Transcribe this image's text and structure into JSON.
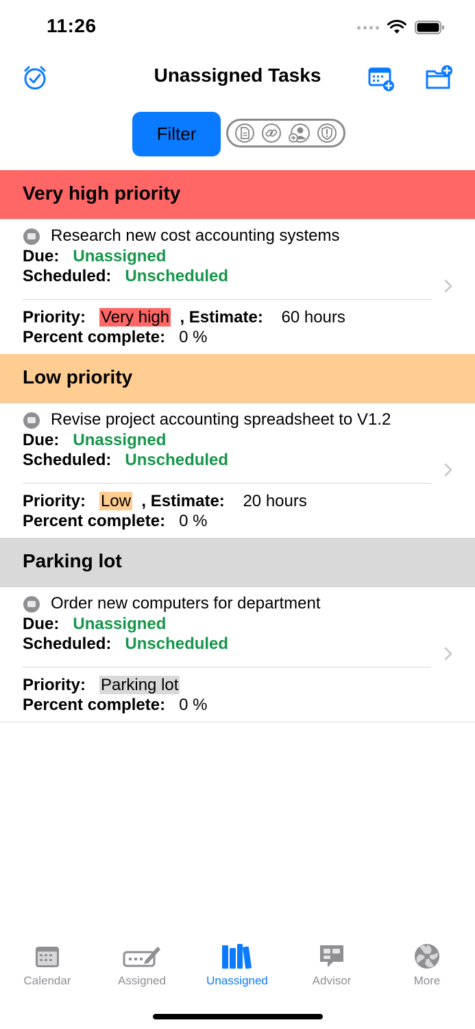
{
  "status": {
    "time": "11:26"
  },
  "nav": {
    "title": "Unassigned Tasks"
  },
  "filter": {
    "label": "Filter"
  },
  "colors": {
    "accent": "#0a7bff",
    "very_high": "#ff6666",
    "low": "#ffcd91",
    "parking": "#d9d9d9",
    "green": "#15964a"
  },
  "sections": [
    {
      "title": "Very high priority",
      "task": {
        "name": "Research new cost accounting systems",
        "due_label": "Due:",
        "due_value": "Unassigned",
        "scheduled_label": "Scheduled:",
        "scheduled_value": "Unscheduled",
        "priority_label": "Priority:",
        "priority_value": "Very high",
        "estimate_label": ", Estimate:",
        "estimate_value": "60 hours",
        "percent_label": "Percent complete:",
        "percent_value": "0  %"
      }
    },
    {
      "title": "Low priority",
      "task": {
        "name": "Revise project accounting spreadsheet to V1.2",
        "due_label": "Due:",
        "due_value": "Unassigned",
        "scheduled_label": "Scheduled:",
        "scheduled_value": "Unscheduled",
        "priority_label": "Priority:",
        "priority_value": "Low",
        "estimate_label": ", Estimate:",
        "estimate_value": "20 hours",
        "percent_label": "Percent complete:",
        "percent_value": "0  %"
      }
    },
    {
      "title": "Parking lot",
      "task": {
        "name": "Order new computers for department",
        "due_label": "Due:",
        "due_value": "Unassigned",
        "scheduled_label": "Scheduled:",
        "scheduled_value": "Unscheduled",
        "priority_label": "Priority:",
        "priority_value": "Parking lot",
        "percent_label": "Percent complete:",
        "percent_value": "0  %"
      }
    }
  ],
  "tabs": [
    {
      "label": "Calendar",
      "icon": "calendar-icon"
    },
    {
      "label": "Assigned",
      "icon": "assigned-icon"
    },
    {
      "label": "Unassigned",
      "icon": "books-icon"
    },
    {
      "label": "Advisor",
      "icon": "advisor-icon"
    },
    {
      "label": "More",
      "icon": "more-icon"
    }
  ]
}
